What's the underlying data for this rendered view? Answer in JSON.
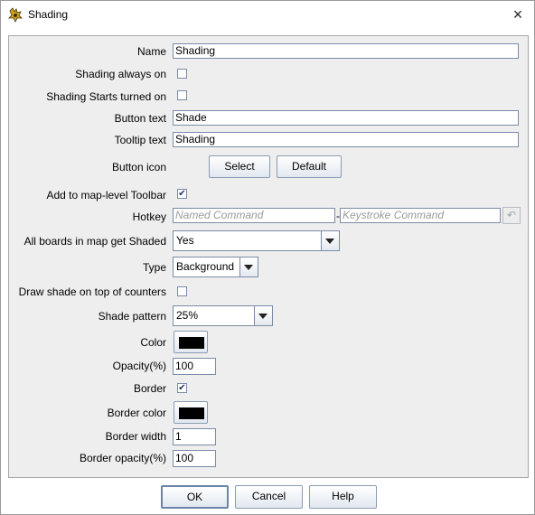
{
  "window": {
    "title": "Shading",
    "icon": "app-logo-icon",
    "close": "×"
  },
  "form": {
    "name_label": "Name",
    "name_value": "Shading",
    "always_on_label": "Shading always on",
    "always_on_checked": "",
    "starts_on_label": "Shading Starts turned on",
    "starts_on_checked": "",
    "button_text_label": "Button text",
    "button_text_value": "Shade",
    "tooltip_label": "Tooltip text",
    "tooltip_value": "Shading",
    "button_icon_label": "Button icon",
    "select_label": "Select",
    "default_label": "Default",
    "toolbar_label": "Add to map-level Toolbar",
    "toolbar_checked": "✔",
    "hotkey_label": "Hotkey",
    "named_command_placeholder": "Named Command",
    "hotkey_dash": "-",
    "keystroke_placeholder": "Keystroke Command",
    "undo_icon": "↶",
    "boards_label": "All boards in map get Shaded",
    "boards_value": "Yes",
    "type_label": "Type",
    "type_value": "Background",
    "draw_on_top_label": "Draw shade on top of counters",
    "draw_on_top_checked": "",
    "pattern_label": "Shade pattern",
    "pattern_value": "25%",
    "color_label": "Color",
    "color_value": "#000000",
    "opacity_label": "Opacity(%)",
    "opacity_value": "100",
    "border_label": "Border",
    "border_checked": "✔",
    "border_color_label": "Border color",
    "border_color_value": "#000000",
    "border_width_label": "Border width",
    "border_width_value": "1",
    "border_opacity_label": "Border opacity(%)",
    "border_opacity_value": "100"
  },
  "footer": {
    "ok": "OK",
    "cancel": "Cancel",
    "help": "Help"
  }
}
